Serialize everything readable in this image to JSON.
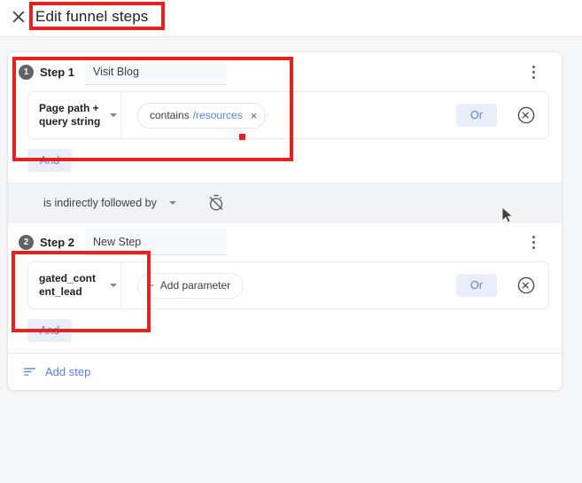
{
  "header": {
    "title": "Edit funnel steps",
    "close_label": "Close"
  },
  "colors": {
    "accent_blue": "#5b7fe3",
    "annotation_red": "#e8211e",
    "badge_gray": "#5f6368",
    "panel_bg": "#f5f6f7"
  },
  "steps": [
    {
      "number": "1",
      "label": "Step 1",
      "name_value": "Visit Blog",
      "dimension": "Page path + query string",
      "condition": {
        "operator": "contains",
        "value": "/resources",
        "remove_label": "×"
      },
      "or_label": "Or",
      "and_label": "And",
      "remove_label": "Remove step",
      "menu_label": "More options"
    },
    {
      "number": "2",
      "label": "Step 2",
      "name_value": "New Step",
      "dimension": "gated_content_lead",
      "add_parameter_label": "Add parameter",
      "or_label": "Or",
      "and_label": "And",
      "remove_label": "Remove step",
      "menu_label": "More options"
    }
  ],
  "connector": {
    "text": "is indirectly followed by",
    "timer_label": "Set time constraint"
  },
  "footer": {
    "add_step_label": "Add step"
  }
}
